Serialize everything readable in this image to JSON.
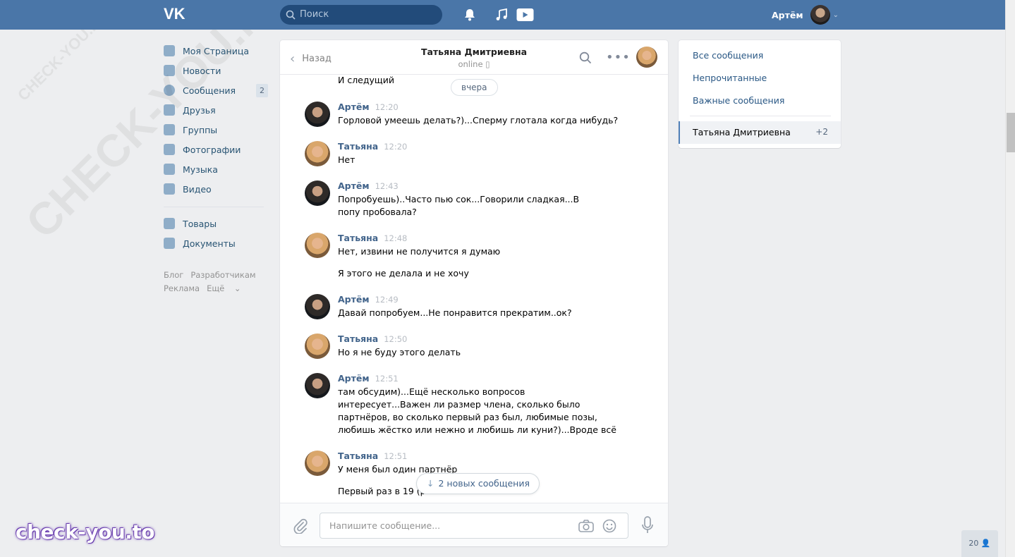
{
  "watermark": {
    "large": "CHECK-YOU.ME",
    "small": "CHECK-YOU.ME",
    "brand": "check-you.to"
  },
  "header": {
    "logo": "VK",
    "search_placeholder": "Поиск",
    "user_name": "Артём",
    "icons": [
      "bell-icon",
      "music-icon",
      "video-icon"
    ]
  },
  "sidebar": {
    "items": [
      {
        "label": "Моя Страница",
        "icon": "home-icon"
      },
      {
        "label": "Новости",
        "icon": "news-icon"
      },
      {
        "label": "Сообщения",
        "icon": "messages-icon",
        "badge": "2"
      },
      {
        "label": "Друзья",
        "icon": "friends-icon"
      },
      {
        "label": "Группы",
        "icon": "groups-icon"
      },
      {
        "label": "Фотографии",
        "icon": "camera-icon"
      },
      {
        "label": "Музыка",
        "icon": "music-icon"
      },
      {
        "label": "Видео",
        "icon": "video-icon"
      }
    ],
    "items2": [
      {
        "label": "Товары",
        "icon": "bag-icon"
      },
      {
        "label": "Документы",
        "icon": "document-icon"
      }
    ],
    "footer": {
      "blog": "Блог",
      "dev": "Разработчикам",
      "ads": "Реклама",
      "more": "Ещё"
    }
  },
  "chat": {
    "back_label": "Назад",
    "peer_name": "Татьяна Дмитриевна",
    "peer_status": "online",
    "first_line": "И следущий",
    "date_pill": "вчера",
    "messages": [
      {
        "author": "Артём",
        "time": "12:20",
        "text": "Горловой умеешь делать?)...Сперму глотала когда нибудь?"
      },
      {
        "author": "Татьяна",
        "time": "12:20",
        "text": "Нет"
      },
      {
        "author": "Артём",
        "time": "12:43",
        "text": "Попробуешь)..Часто пью сок...Говорили сладкая...В попу пробовала?"
      },
      {
        "author": "Татьяна",
        "time": "12:48",
        "text": "Нет, извини не получится я думаю",
        "extra": "Я этого не делала и не хочу"
      },
      {
        "author": "Артём",
        "time": "12:49",
        "text": "Давай попробуем...Не понравится прекратим..ок?"
      },
      {
        "author": "Татьяна",
        "time": "12:50",
        "text": "Но я не буду этого делать"
      },
      {
        "author": "Артём",
        "time": "12:51",
        "text": "там обсудим)...Ещё несколько вопросов интересует...Важен ли размер члена, сколько было партнёров, во сколько первый раз был, любимые позы, любишь жёстко или нежно и любишь ли куни?)...Вроде всё"
      },
      {
        "author": "Татьяна",
        "time": "12:51",
        "text": "У меня был один партнёр",
        "extra": "Первый раз в 19 (р"
      }
    ],
    "new_messages": "2 новых сообщения",
    "composer_placeholder": "Напишите сообщение..."
  },
  "right_panel": {
    "all": "Все сообщения",
    "unread": "Непрочитанные",
    "important": "Важные сообщения",
    "selected_name": "Татьяна Дмитриевна",
    "selected_count": "+2"
  },
  "online_counter": "20"
}
